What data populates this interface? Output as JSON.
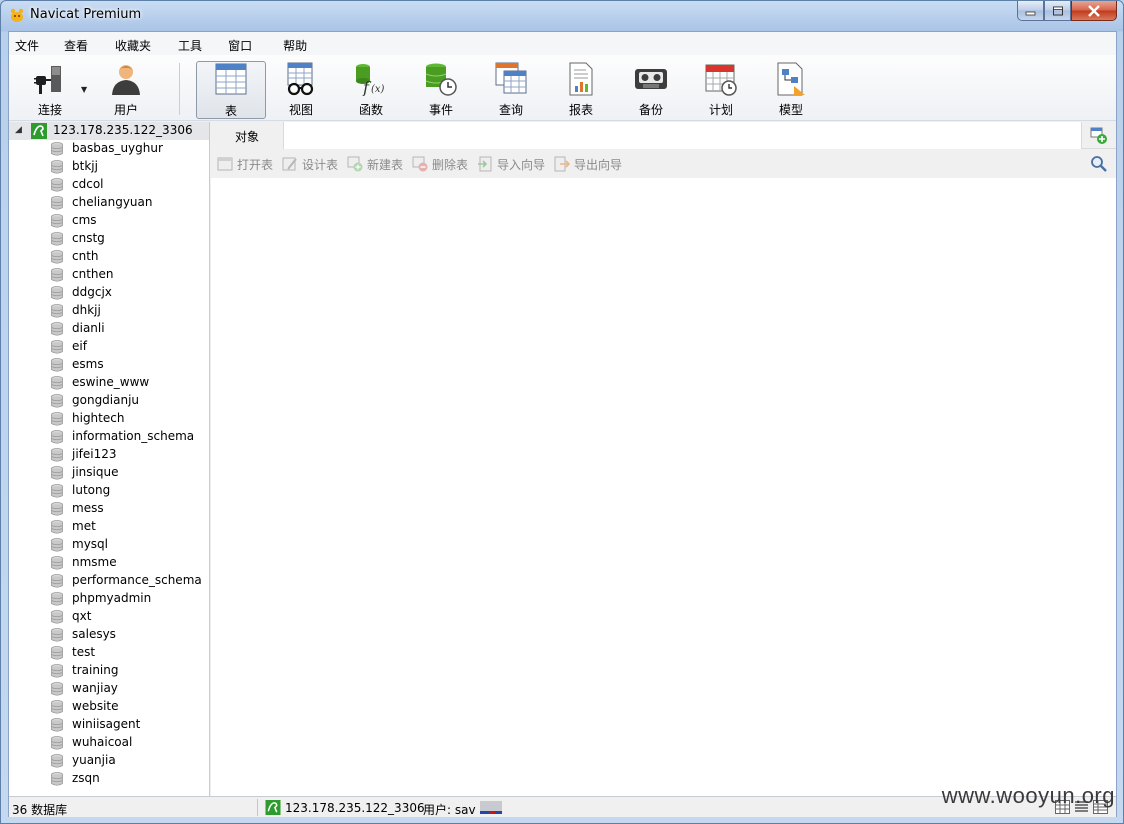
{
  "window": {
    "title": "Navicat Premium"
  },
  "menu": [
    "文件",
    "查看",
    "收藏夹",
    "工具",
    "窗口",
    "帮助"
  ],
  "toolbar": {
    "connect": "连接",
    "user": "用户",
    "table": "表",
    "view": "视图",
    "function": "函数",
    "event": "事件",
    "query": "查询",
    "report": "报表",
    "backup": "备份",
    "schedule": "计划",
    "model": "模型"
  },
  "connection": {
    "name": "123.178.235.122_3306"
  },
  "databases": [
    "basbas_uyghur",
    "btkjj",
    "cdcol",
    "cheliangyuan",
    "cms",
    "cnstg",
    "cnth",
    "cnthen",
    "ddgcjx",
    "dhkjj",
    "dianli",
    "eif",
    "esms",
    "eswine_www",
    "gongdianju",
    "hightech",
    "information_schema",
    "jifei123",
    "jinsique",
    "lutong",
    "mess",
    "met",
    "mysql",
    "nmsme",
    "performance_schema",
    "phpmyadmin",
    "qxt",
    "salesys",
    "test",
    "training",
    "wanjiay",
    "website",
    "winiisagent",
    "wuhaicoal",
    "yuanjia",
    "zsqn"
  ],
  "object_tab": {
    "label": "对象"
  },
  "actions": {
    "open_table": "打开表",
    "design_table": "设计表",
    "new_table": "新建表",
    "delete_table": "删除表",
    "import_wizard": "导入向导",
    "export_wizard": "导出向导"
  },
  "status": {
    "db_count": "36 数据库",
    "connection": "123.178.235.122_3306",
    "user": "用户: sav"
  },
  "watermark": "www.wooyun.org"
}
